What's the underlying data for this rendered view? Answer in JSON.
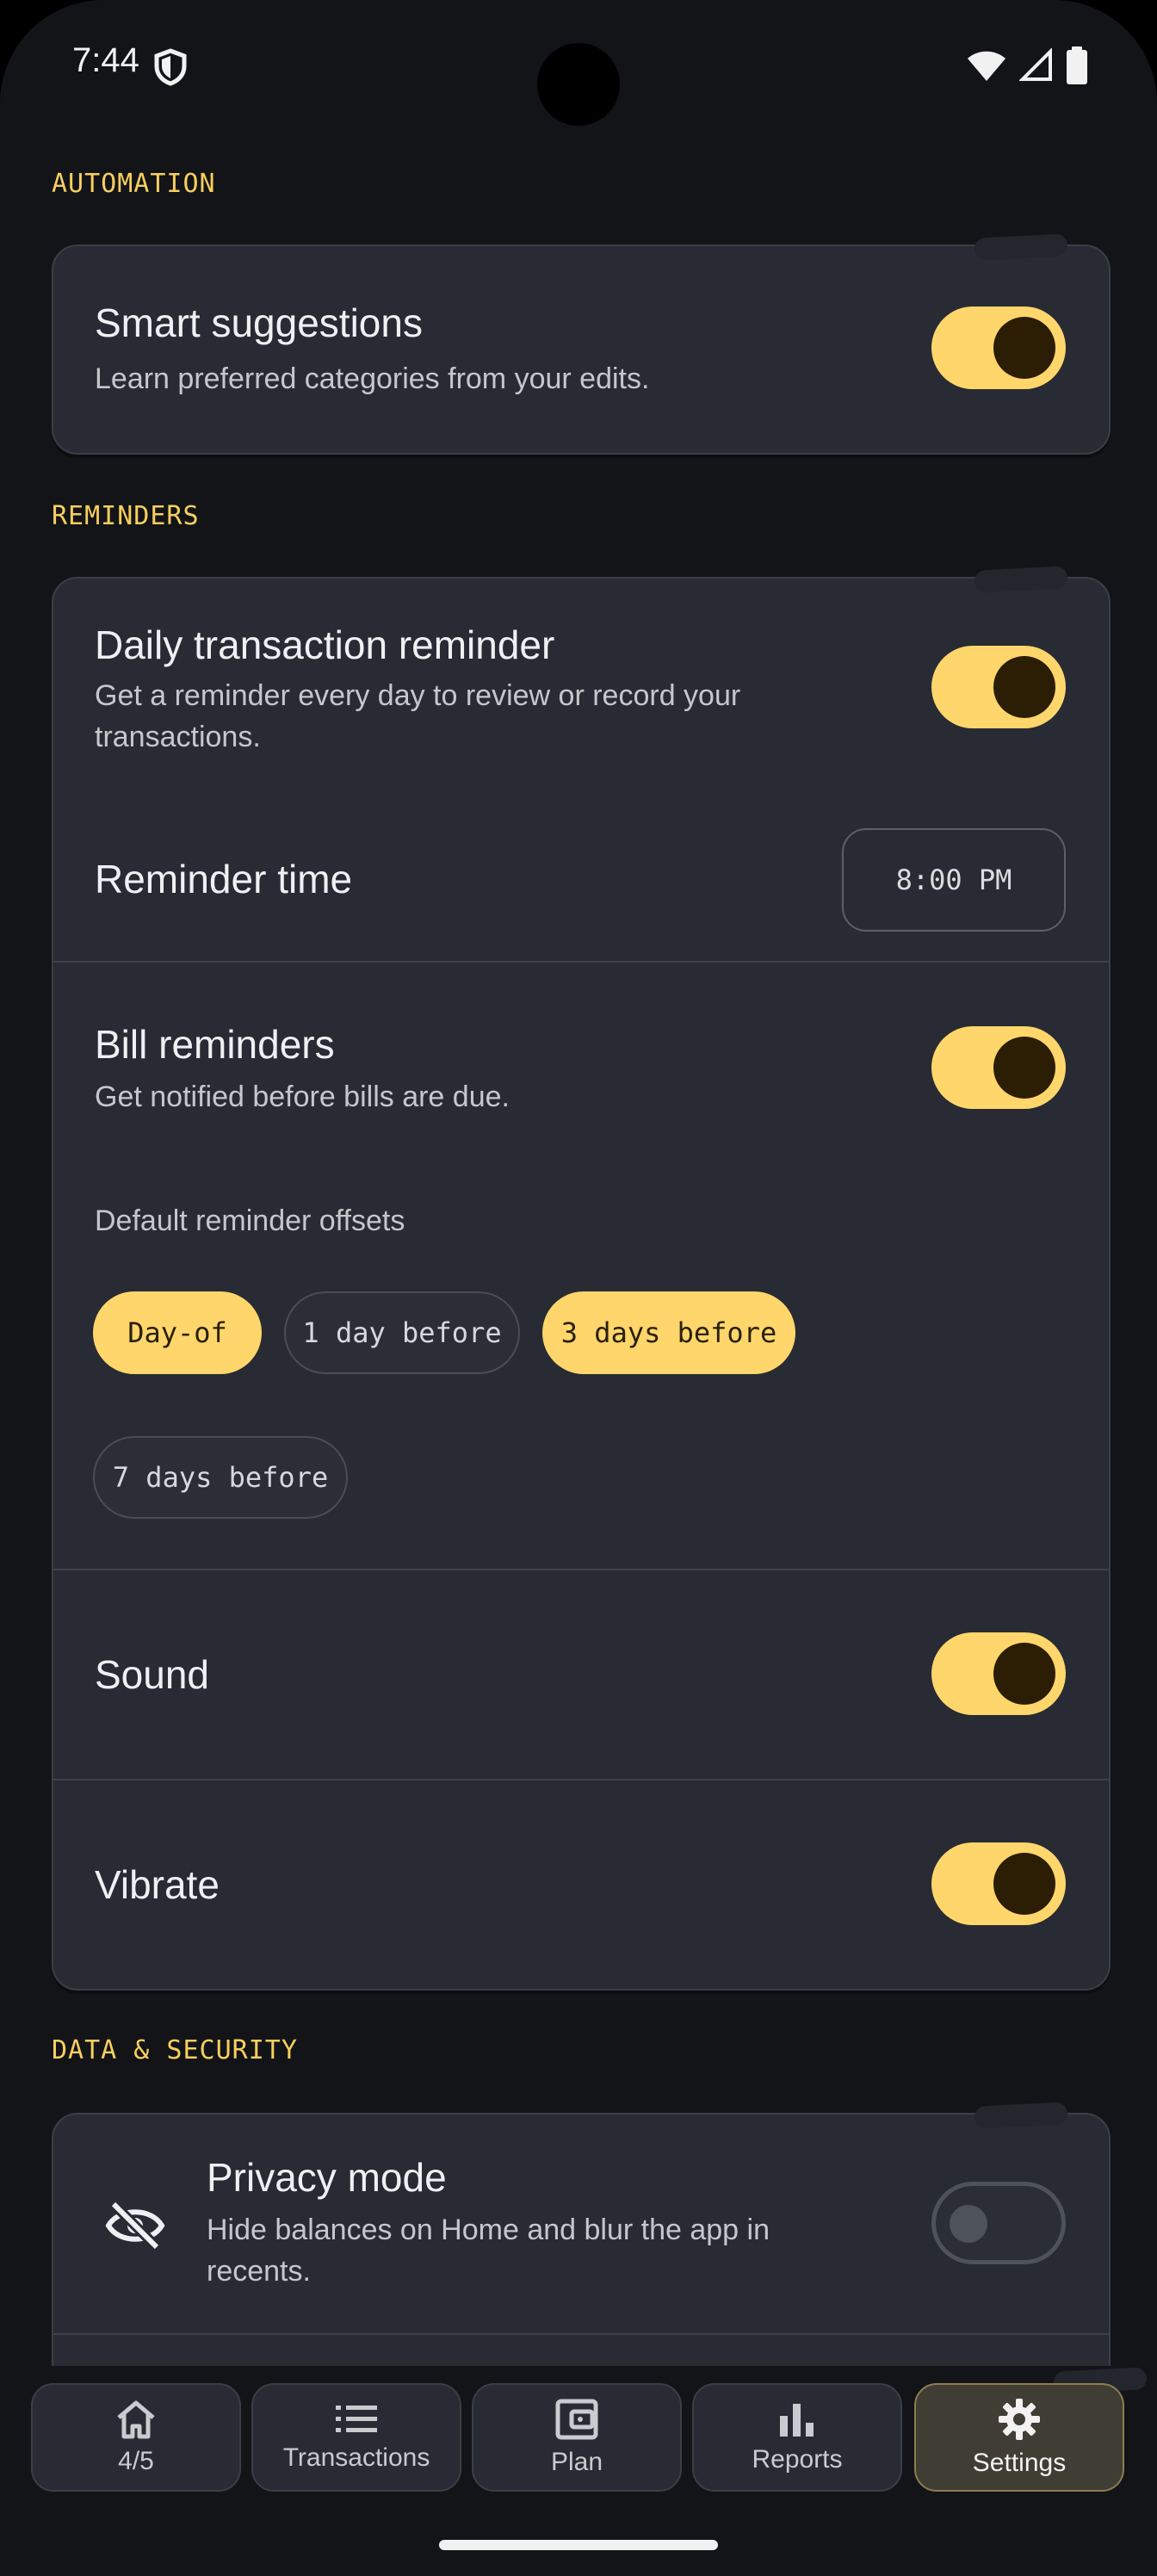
{
  "status_bar": {
    "time": "7:44"
  },
  "sections": {
    "automation": {
      "title": "AUTOMATION"
    },
    "reminders": {
      "title": "REMINDERS"
    },
    "data_security": {
      "title": "DATA & SECURITY"
    }
  },
  "smart_suggestions": {
    "title": "Smart suggestions",
    "subtitle": "Learn preferred categories from your edits.",
    "enabled": true
  },
  "daily_reminder": {
    "title": "Daily transaction reminder",
    "subtitle_line1": "Get a reminder every day to review or record your",
    "subtitle_line2": "transactions.",
    "enabled": true
  },
  "reminder_time": {
    "title": "Reminder time",
    "value": "8:00 PM"
  },
  "bill_reminders": {
    "title": "Bill reminders",
    "subtitle": "Get notified before bills are due.",
    "enabled": true,
    "offsets_label": "Default reminder offsets",
    "offsets": [
      {
        "label": "Day-of",
        "selected": true
      },
      {
        "label": "1 day before",
        "selected": false
      },
      {
        "label": "3 days before",
        "selected": true
      },
      {
        "label": "7 days before",
        "selected": false
      }
    ]
  },
  "sound": {
    "title": "Sound",
    "enabled": true
  },
  "vibrate": {
    "title": "Vibrate",
    "enabled": true
  },
  "privacy_mode": {
    "title": "Privacy mode",
    "subtitle_line1": "Hide balances on Home and blur the app in",
    "subtitle_line2": "recents.",
    "enabled": false,
    "icon": "eye-off-icon"
  },
  "nav": [
    {
      "label": "4/5",
      "icon": "home-icon",
      "active": false
    },
    {
      "label": "Transactions",
      "icon": "list-icon",
      "active": false
    },
    {
      "label": "Plan",
      "icon": "wallet-icon",
      "active": false
    },
    {
      "label": "Reports",
      "icon": "bar-chart-icon",
      "active": false
    },
    {
      "label": "Settings",
      "icon": "gear-icon",
      "active": true
    }
  ],
  "colors": {
    "accent": "#ffd66b",
    "background": "#131418",
    "card": "#282b33",
    "section_header": "#f7cf5e"
  }
}
